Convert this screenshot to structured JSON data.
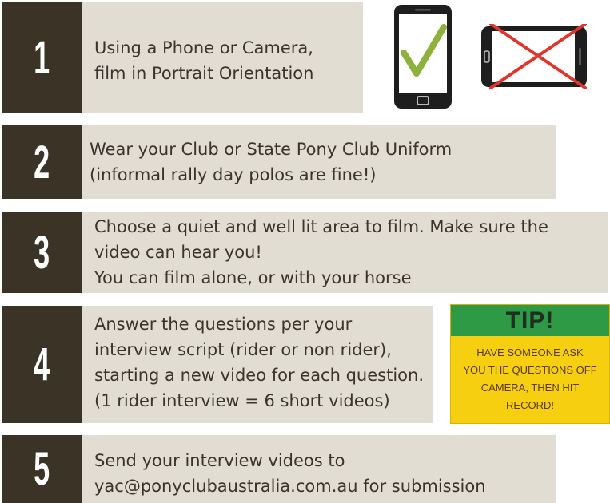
{
  "steps": [
    {
      "number": "1",
      "lines": [
        "Using a Phone or Camera,",
        "film in Portrait Orientation"
      ]
    },
    {
      "number": "2",
      "lines": [
        "Wear your Club or State Pony Club Uniform",
        "(informal rally day polos are fine!)"
      ]
    },
    {
      "number": "3",
      "lines": [
        "Choose a quiet and well lit area to film. Make sure the",
        "video can hear you!",
        "You can film alone, or with your horse"
      ]
    },
    {
      "number": "4",
      "lines": [
        "Answer the questions per your",
        "interview script (rider or non rider),",
        "starting a new video for each question.",
        "(1 rider interview = 6 short videos)"
      ]
    },
    {
      "number": "5",
      "lines": [
        "Send your interview videos to",
        "yac@ponyclubaustralia.com.au for submission"
      ]
    }
  ],
  "tip": {
    "title": "TIP!",
    "lines": [
      "HAVE SOMEONE ASK",
      "YOU THE QUESTIONS OFF",
      "CAMERA, THEN HIT",
      "RECORD!"
    ]
  },
  "icons": {
    "portrait": "phone-portrait-checkmark-icon",
    "landscape": "phone-landscape-cross-icon"
  },
  "colors": {
    "number_block": "#3b3326",
    "step_background": "#e2ddd3",
    "text": "#3a342c",
    "check": "#8cb23c",
    "cross": "#e0352b",
    "tip_header": "#2f9a45",
    "tip_body": "#f5cf10"
  }
}
